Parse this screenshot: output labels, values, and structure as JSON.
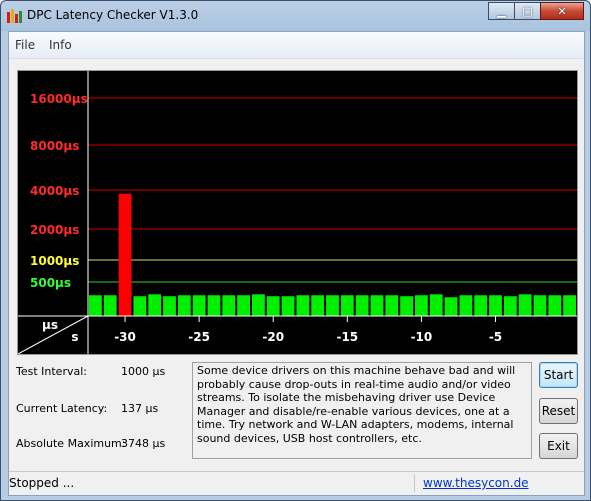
{
  "window": {
    "title": "DPC Latency Checker V1.3.0"
  },
  "menu": {
    "items": [
      "File",
      "Info"
    ]
  },
  "graph": {
    "y_ticks": [
      {
        "label": "16000µs",
        "color": "#ff2a2a"
      },
      {
        "label": "8000µs",
        "color": "#ff2a2a"
      },
      {
        "label": "4000µs",
        "color": "#ff2a2a"
      },
      {
        "label": "2000µs",
        "color": "#ff2a2a"
      },
      {
        "label": "1000µs",
        "color": "#ffff33"
      },
      {
        "label": "500µs",
        "color": "#33ff33"
      }
    ],
    "axis_corner": {
      "y_unit": "µs",
      "x_unit": "s"
    },
    "x_ticks": [
      "-30",
      "-25",
      "-20",
      "-15",
      "-10",
      "-5"
    ]
  },
  "chart_data": {
    "type": "bar",
    "title": "",
    "xlabel": "s",
    "ylabel": "µs",
    "y_scale": "log2",
    "ylim": [
      250,
      22000
    ],
    "x": [
      -32,
      -31,
      -30,
      -29,
      -28,
      -27,
      -26,
      -25,
      -24,
      -23,
      -22,
      -21,
      -20,
      -19,
      -18,
      -17,
      -16,
      -15,
      -14,
      -13,
      -12,
      -11,
      -10,
      -9,
      -8,
      -7,
      -6,
      -5,
      -4,
      -3,
      -2,
      -1,
      0
    ],
    "values": [
      330,
      330,
      3748,
      320,
      340,
      320,
      330,
      330,
      330,
      330,
      330,
      340,
      320,
      320,
      330,
      330,
      330,
      330,
      330,
      330,
      330,
      320,
      330,
      340,
      310,
      330,
      330,
      330,
      320,
      340,
      330,
      330,
      330
    ],
    "colors": [
      "#00ee00",
      "#00ee00",
      "#ff0000",
      "#00ee00",
      "#00ee00",
      "#00ee00",
      "#00ee00",
      "#00ee00",
      "#00ee00",
      "#00ee00",
      "#00ee00",
      "#00ee00",
      "#00ee00",
      "#00ee00",
      "#00ee00",
      "#00ee00",
      "#00ee00",
      "#00ee00",
      "#00ee00",
      "#00ee00",
      "#00ee00",
      "#00ee00",
      "#00ee00",
      "#00ee00",
      "#00ee00",
      "#00ee00",
      "#00ee00",
      "#00ee00",
      "#00ee00",
      "#00ee00",
      "#00ee00",
      "#00ee00",
      "#00ee00"
    ],
    "x_tick_labels": [
      "-30",
      "-25",
      "-20",
      "-15",
      "-10",
      "-5"
    ]
  },
  "stats": {
    "test_interval_label": "Test Interval:",
    "test_interval_value": "1000 µs",
    "current_latency_label": "Current Latency:",
    "current_latency_value": "137 µs",
    "absolute_maximum_label": "Absolute Maximum:",
    "absolute_maximum_value": "3748 µs"
  },
  "info_text": "Some device drivers on this machine behave bad and will probably cause drop-outs in real-time audio and/or video streams. To isolate the misbehaving driver use Device Manager and disable/re-enable various devices, one at a time. Try network and W-LAN adapters, modems, internal sound devices, USB host controllers, etc.",
  "buttons": {
    "start": "Start",
    "reset": "Reset",
    "exit": "Exit"
  },
  "statusbar": {
    "status": "Stopped ...",
    "link": "www.thesycon.de"
  }
}
